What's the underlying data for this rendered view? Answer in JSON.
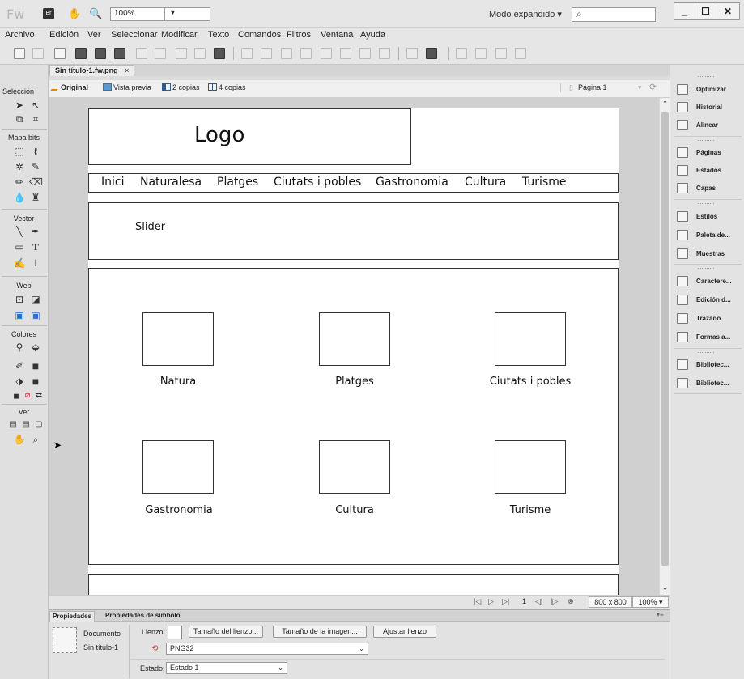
{
  "title_bar": {
    "app_logo": "Fw",
    "bridge_label": "Br",
    "zoom_value": "100%",
    "workspace_mode": "Modo expandido ▾",
    "search_placeholder": "",
    "window_buttons": [
      "_",
      "☐",
      "✕"
    ]
  },
  "menu": [
    "Archivo",
    "Edición",
    "Ver",
    "Seleccionar",
    "Modificar",
    "Texto",
    "Comandos",
    "Filtros",
    "Ventana",
    "Ayuda"
  ],
  "document_tab": {
    "label": "Sin título-1.fw.png",
    "close": "×"
  },
  "view_bar": {
    "original": "Original",
    "preview": "Vista previa",
    "two_up": "2 copias",
    "four_up": "4 copias",
    "page": "Página 1"
  },
  "tools_panel": {
    "sections": [
      "Selección",
      "Mapa bits",
      "Vector",
      "Web",
      "Colores",
      "Ver"
    ]
  },
  "canvas": {
    "logo": "Logo",
    "nav": [
      "Inici",
      "Naturalesa",
      "Platges",
      "Ciutats i pobles",
      "Gastronomia",
      "Cultura",
      "Turisme"
    ],
    "slider": "Slider",
    "tiles": [
      "Natura",
      "Platges",
      "Ciutats i pobles",
      "Gastronomia",
      "Cultura",
      "Turisme"
    ]
  },
  "status_bar": {
    "frame_number": "1",
    "canvas_size": "800 x 800",
    "zoom": "100%"
  },
  "properties": {
    "tabs": [
      "Propiedades",
      "Propiedades de símbolo"
    ],
    "doc_type": "Documento",
    "doc_name": "Sin título-1",
    "canvas_label": "Lienzo:",
    "btn_canvas_size": "Tamaño del lienzo...",
    "btn_image_size": "Tamaño de la imagen...",
    "btn_fit_canvas": "Ajustar lienzo",
    "format": "PNG32",
    "state_label": "Estado:",
    "state_value": "Estado 1"
  },
  "right_dock": {
    "groups": [
      [
        "Optimizar",
        "Historial",
        "Alinear"
      ],
      [
        "Páginas",
        "Estados",
        "Capas"
      ],
      [
        "Estilos",
        "Paleta de...",
        "Muestras"
      ],
      [
        "Caractere...",
        "Edición d...",
        "Trazado",
        "Formas a..."
      ],
      [
        "Bibliotec...",
        "Bibliotec..."
      ]
    ]
  }
}
